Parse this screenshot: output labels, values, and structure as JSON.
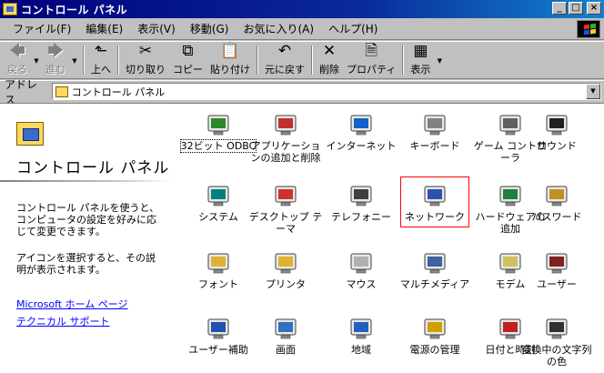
{
  "window": {
    "title": "コントロール パネル",
    "buttons": {
      "minimize": "_",
      "maximize": "□",
      "close": "×"
    }
  },
  "menu": [
    "ファイル(F)",
    "編集(E)",
    "表示(V)",
    "移動(G)",
    "お気に入り(A)",
    "ヘルプ(H)"
  ],
  "toolbar": [
    {
      "name": "back",
      "label": "戻る",
      "icon": "back-arrow-icon",
      "glyph": "🡄",
      "disabled": true,
      "dropdown": true
    },
    {
      "name": "forward",
      "label": "進む",
      "icon": "forward-arrow-icon",
      "glyph": "🡆",
      "disabled": true,
      "dropdown": true
    },
    {
      "name": "up",
      "label": "上へ",
      "icon": "folder-up-icon",
      "glyph": "⬑",
      "disabled": false
    },
    {
      "name": "cut",
      "label": "切り取り",
      "icon": "scissors-icon",
      "glyph": "✂",
      "disabled": false
    },
    {
      "name": "copy",
      "label": "コピー",
      "icon": "copy-icon",
      "glyph": "⧉",
      "disabled": false
    },
    {
      "name": "paste",
      "label": "貼り付け",
      "icon": "paste-icon",
      "glyph": "📋",
      "disabled": false
    },
    {
      "name": "undo",
      "label": "元に戻す",
      "icon": "undo-icon",
      "glyph": "↶",
      "disabled": false
    },
    {
      "name": "delete",
      "label": "削除",
      "icon": "delete-x-icon",
      "glyph": "✕",
      "disabled": false
    },
    {
      "name": "properties",
      "label": "プロパティ",
      "icon": "properties-icon",
      "glyph": "🗎",
      "disabled": false
    },
    {
      "name": "views",
      "label": "表示",
      "icon": "views-grid-icon",
      "glyph": "▦",
      "disabled": false,
      "dropdown": true
    }
  ],
  "address": {
    "label": "アドレス",
    "value": "コントロール パネル"
  },
  "panel": {
    "title": "コントロール パネル",
    "description": "コントロール パネルを使うと、コンピュータの設定を好みに応じて変更できます。",
    "hint": "アイコンを選択すると、その説明が表示されます。",
    "links": [
      "Microsoft ホーム ページ",
      "テクニカル サポート"
    ]
  },
  "icons": [
    {
      "label": "32ビット ODBC",
      "icon": "odbc-database-icon",
      "color": "#2a8a2a",
      "selected": false,
      "focus": true
    },
    {
      "label": "アプリケーションの追加と削除",
      "icon": "add-remove-programs-icon",
      "color": "#c03030",
      "selected": false
    },
    {
      "label": "インターネット",
      "icon": "internet-explorer-icon",
      "color": "#1560c8",
      "selected": false
    },
    {
      "label": "キーボード",
      "icon": "keyboard-icon",
      "color": "#808080",
      "selected": false
    },
    {
      "label": "ゲーム コントローラ",
      "icon": "game-controller-icon",
      "color": "#606060",
      "selected": false
    },
    {
      "label": "サウンド",
      "icon": "speaker-icon",
      "color": "#202020",
      "selected": false
    },
    {
      "label": "システム",
      "icon": "computer-monitor-icon",
      "color": "#008080",
      "selected": false
    },
    {
      "label": "デスクトップ テーマ",
      "icon": "desktop-themes-icon",
      "color": "#d03030",
      "selected": false
    },
    {
      "label": "テレフォニー",
      "icon": "telephony-icon",
      "color": "#404040",
      "selected": false
    },
    {
      "label": "ネットワーク",
      "icon": "network-icon",
      "color": "#3050b0",
      "selected": true
    },
    {
      "label": "ハードウェアの追加",
      "icon": "add-hardware-icon",
      "color": "#208040",
      "selected": false
    },
    {
      "label": "パスワード",
      "icon": "password-keys-icon",
      "color": "#c09020",
      "selected": false
    },
    {
      "label": "フォント",
      "icon": "fonts-folder-icon",
      "color": "#e0b030",
      "selected": false
    },
    {
      "label": "プリンタ",
      "icon": "printers-folder-icon",
      "color": "#e0b030",
      "selected": false
    },
    {
      "label": "マウス",
      "icon": "mouse-icon",
      "color": "#b0b0b0",
      "selected": false
    },
    {
      "label": "マルチメディア",
      "icon": "multimedia-icon",
      "color": "#4060a0",
      "selected": false
    },
    {
      "label": "モデム",
      "icon": "modem-phone-icon",
      "color": "#d0c060",
      "selected": false
    },
    {
      "label": "ユーザー",
      "icon": "users-icon",
      "color": "#802020",
      "selected": false
    },
    {
      "label": "ユーザー補助",
      "icon": "accessibility-icon",
      "color": "#2050b0",
      "selected": false
    },
    {
      "label": "画面",
      "icon": "display-icon",
      "color": "#3070c0",
      "selected": false
    },
    {
      "label": "地域",
      "icon": "globe-icon",
      "color": "#2060c0",
      "selected": false
    },
    {
      "label": "電源の管理",
      "icon": "power-management-icon",
      "color": "#d0a000",
      "selected": false
    },
    {
      "label": "日付と時刻",
      "icon": "date-time-icon",
      "color": "#c02020",
      "selected": false
    },
    {
      "label": "変換中の文字列の色",
      "icon": "ime-color-icon",
      "color": "#303030",
      "selected": false
    }
  ]
}
